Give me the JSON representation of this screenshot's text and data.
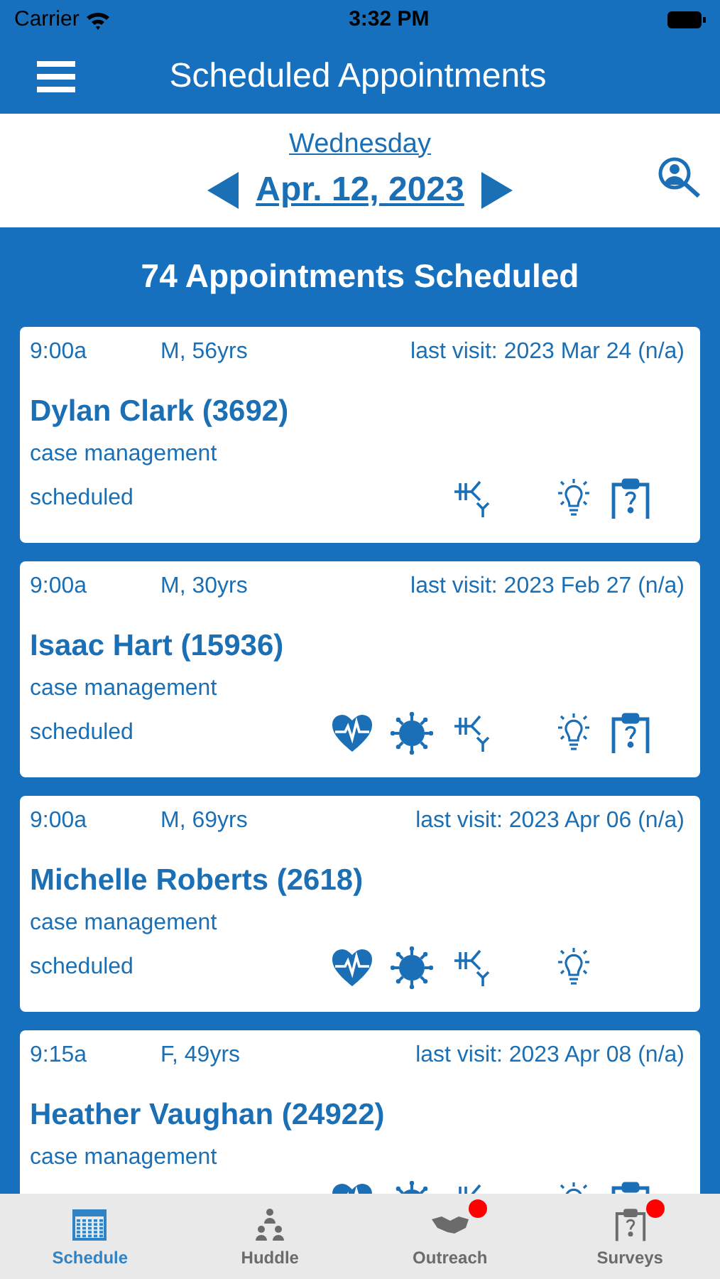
{
  "status_bar": {
    "carrier": "Carrier",
    "time": "3:32 PM"
  },
  "header": {
    "title": "Scheduled Appointments"
  },
  "date_bar": {
    "weekday": "Wednesday",
    "date": "Apr. 12, 2023"
  },
  "summary": "74 Appointments Scheduled",
  "appointments": [
    {
      "time": "9:00a",
      "demographics": "M, 56yrs",
      "last_visit": "last visit: 2023 Mar 24 (n/a)",
      "name": "Dylan Clark (3692)",
      "type": "case management",
      "status": "scheduled",
      "heart": false,
      "virus": false,
      "hk": true,
      "bulb": true,
      "survey": true
    },
    {
      "time": "9:00a",
      "demographics": "M, 30yrs",
      "last_visit": "last visit: 2023 Feb 27 (n/a)",
      "name": "Isaac Hart (15936)",
      "type": "case management",
      "status": "scheduled",
      "heart": true,
      "virus": true,
      "hk": true,
      "bulb": true,
      "survey": true
    },
    {
      "time": "9:00a",
      "demographics": "M, 69yrs",
      "last_visit": "last visit: 2023 Apr 06 (n/a)",
      "name": "Michelle Roberts (2618)",
      "type": "case management",
      "status": "scheduled",
      "heart": true,
      "virus": true,
      "hk": true,
      "bulb": true,
      "survey": false
    },
    {
      "time": "9:15a",
      "demographics": "F, 49yrs",
      "last_visit": "last visit: 2023 Apr 08 (n/a)",
      "name": "Heather Vaughan (24922)",
      "type": "case management",
      "heart": true,
      "virus": true,
      "hk": true,
      "bulb": true,
      "survey": true
    }
  ],
  "tabs": [
    {
      "label": "Schedule",
      "kind": "calendar",
      "selected": true,
      "badge": false
    },
    {
      "label": "Huddle",
      "kind": "people",
      "selected": false,
      "badge": false
    },
    {
      "label": "Outreach",
      "kind": "handshake",
      "selected": false,
      "badge": true
    },
    {
      "label": "Surveys",
      "kind": "survey",
      "selected": false,
      "badge": true
    }
  ]
}
